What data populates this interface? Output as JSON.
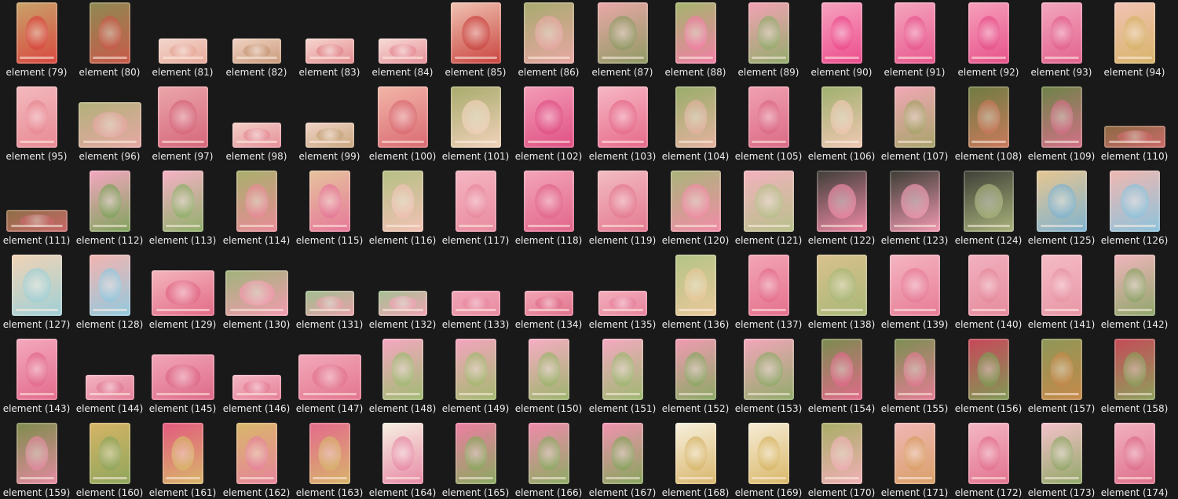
{
  "window": {
    "view": "file-grid",
    "background": "#191919"
  },
  "items": [
    {
      "label": "element (79)",
      "icon": "heart-topiary-icon",
      "colors": [
        "#c9a36a",
        "#d8483f"
      ],
      "shape": "tall"
    },
    {
      "label": "element (80)",
      "icon": "ball-topiary-icon",
      "colors": [
        "#8e8a52",
        "#c95a4a"
      ],
      "shape": "tall"
    },
    {
      "label": "element (81)",
      "icon": "open-book-icon",
      "colors": [
        "#f3d6cc",
        "#e7a99a"
      ],
      "shape": "flat"
    },
    {
      "label": "element (82)",
      "icon": "open-book-icon",
      "colors": [
        "#f0d3c3",
        "#c99a7a"
      ],
      "shape": "flat"
    },
    {
      "label": "element (83)",
      "icon": "open-planner-icon",
      "colors": [
        "#f6d7d0",
        "#e38a8f"
      ],
      "shape": "flat"
    },
    {
      "label": "element (84)",
      "icon": "open-planner-icon",
      "colors": [
        "#f7dcd6",
        "#e58e98"
      ],
      "shape": "flat"
    },
    {
      "label": "element (85)",
      "icon": "book-stack-apple-icon",
      "colors": [
        "#f0c3b2",
        "#c9443f"
      ],
      "shape": "square"
    },
    {
      "label": "element (86)",
      "icon": "book-stack-icon",
      "colors": [
        "#a7aa6e",
        "#e8a7a4"
      ],
      "shape": "square"
    },
    {
      "label": "element (87)",
      "icon": "book-stack-icon",
      "colors": [
        "#eaa8a8",
        "#8f9a64"
      ],
      "shape": "square"
    },
    {
      "label": "element (88)",
      "icon": "clipboard-frame-icon",
      "colors": [
        "#a3b56d",
        "#f27fa6"
      ],
      "shape": "tall"
    },
    {
      "label": "element (89)",
      "icon": "clipboard-frame-icon",
      "colors": [
        "#f3a2b4",
        "#93ac6c"
      ],
      "shape": "tall"
    },
    {
      "label": "element (90)",
      "icon": "floral-wreath-frame-icon",
      "colors": [
        "#f6a3bf",
        "#ec4d8d"
      ],
      "shape": "tall"
    },
    {
      "label": "element (91)",
      "icon": "floral-frame-icon",
      "colors": [
        "#f4a5bd",
        "#e8598f"
      ],
      "shape": "tall"
    },
    {
      "label": "element (92)",
      "icon": "heart-frame-icon",
      "colors": [
        "#f7a0bb",
        "#e6528a"
      ],
      "shape": "tall"
    },
    {
      "label": "element (93)",
      "icon": "oval-floral-frame-icon",
      "colors": [
        "#f3a7be",
        "#e2628e"
      ],
      "shape": "tall"
    },
    {
      "label": "element (94)",
      "icon": "oval-frame-icon",
      "colors": [
        "#f2c3b4",
        "#d7b46a"
      ],
      "shape": "tall"
    },
    {
      "label": "element (95)",
      "icon": "rect-frame-icon",
      "colors": [
        "#f3b9bd",
        "#e88a94"
      ],
      "shape": "tall"
    },
    {
      "label": "element (96)",
      "icon": "duffel-bag-icon",
      "colors": [
        "#b1b07a",
        "#e7a8a4"
      ],
      "shape": "wide"
    },
    {
      "label": "element (97)",
      "icon": "drawstring-bag-icon",
      "colors": [
        "#eba6aa",
        "#d5667a"
      ],
      "shape": "square"
    },
    {
      "label": "element (98)",
      "icon": "label-plate-icon",
      "colors": [
        "#f3d2c8",
        "#e58e98"
      ],
      "shape": "flat"
    },
    {
      "label": "element (99)",
      "icon": "label-plate-icon",
      "colors": [
        "#f1d4c7",
        "#c8a67e"
      ],
      "shape": "flat"
    },
    {
      "label": "element (100)",
      "icon": "trunk-box-icon",
      "colors": [
        "#f2b6a8",
        "#d96a72"
      ],
      "shape": "square"
    },
    {
      "label": "element (101)",
      "icon": "hat-box-icon",
      "colors": [
        "#a8ab6c",
        "#f1d2bb"
      ],
      "shape": "square"
    },
    {
      "label": "element (102)",
      "icon": "jewelry-box-icon",
      "colors": [
        "#f39db7",
        "#df4f83"
      ],
      "shape": "square"
    },
    {
      "label": "element (103)",
      "icon": "perfume-box-icon",
      "colors": [
        "#f6b7c4",
        "#e66a8a"
      ],
      "shape": "square"
    },
    {
      "label": "element (104)",
      "icon": "quill-feather-icon",
      "colors": [
        "#98ad6a",
        "#e4b2a0"
      ],
      "shape": "tall"
    },
    {
      "label": "element (105)",
      "icon": "quill-feather-icon",
      "colors": [
        "#f0a1b1",
        "#db6a86"
      ],
      "shape": "tall"
    },
    {
      "label": "element (106)",
      "icon": "inkwell-quill-icon",
      "colors": [
        "#9fb06e",
        "#f0c8b3"
      ],
      "shape": "tall"
    },
    {
      "label": "element (107)",
      "icon": "inkwell-quill-icon",
      "colors": [
        "#f2a8b6",
        "#a7a46a"
      ],
      "shape": "tall"
    },
    {
      "label": "element (108)",
      "icon": "topiary-clock-icon",
      "colors": [
        "#6f7c42",
        "#c97a5c"
      ],
      "shape": "tall"
    },
    {
      "label": "element (109)",
      "icon": "cone-topiary-icon",
      "colors": [
        "#6c8347",
        "#d47088"
      ],
      "shape": "tall"
    },
    {
      "label": "element (110)",
      "icon": "floral-border-icon",
      "colors": [
        "#8a6a42",
        "#cc6a6a"
      ],
      "shape": "strip"
    },
    {
      "label": "element (111)",
      "icon": "floral-border-icon",
      "colors": [
        "#8c6e45",
        "#c9686a"
      ],
      "shape": "strip"
    },
    {
      "label": "element (112)",
      "icon": "peony-bouquet-icon",
      "colors": [
        "#f5a6c0",
        "#7fa35c"
      ],
      "shape": "tall"
    },
    {
      "label": "element (113)",
      "icon": "peony-bouquet-icon",
      "colors": [
        "#f7b1c6",
        "#8fb06a"
      ],
      "shape": "tall"
    },
    {
      "label": "element (114)",
      "icon": "microscope-icon",
      "colors": [
        "#a8b06c",
        "#e98a98"
      ],
      "shape": "tall"
    },
    {
      "label": "element (115)",
      "icon": "cash-register-icon",
      "colors": [
        "#e6c39c",
        "#e6789a"
      ],
      "shape": "tall"
    },
    {
      "label": "element (116)",
      "icon": "calculator-icon",
      "colors": [
        "#b5bf83",
        "#f1c2b6"
      ],
      "shape": "tall"
    },
    {
      "label": "element (117)",
      "icon": "calculator-icon",
      "colors": [
        "#f5b5c2",
        "#e88b9f"
      ],
      "shape": "tall"
    },
    {
      "label": "element (118)",
      "icon": "wall-clock-icon",
      "colors": [
        "#f3a5b8",
        "#e1658b"
      ],
      "shape": "square"
    },
    {
      "label": "element (119)",
      "icon": "alarm-clock-icon",
      "colors": [
        "#f2bcc2",
        "#e47990"
      ],
      "shape": "square"
    },
    {
      "label": "element (120)",
      "icon": "school-desk-icon",
      "colors": [
        "#a9b47a",
        "#f28ca7"
      ],
      "shape": "square"
    },
    {
      "label": "element (121)",
      "icon": "school-desk-icon",
      "colors": [
        "#f3b2be",
        "#b7c08b"
      ],
      "shape": "square"
    },
    {
      "label": "element (122)",
      "icon": "easel-chalkboard-icon",
      "colors": [
        "#3e3e37",
        "#f08aa6"
      ],
      "shape": "square"
    },
    {
      "label": "element (123)",
      "icon": "chalkboard-icon",
      "colors": [
        "#3b3c34",
        "#f29ab2"
      ],
      "shape": "square"
    },
    {
      "label": "element (124)",
      "icon": "chalkboard-icon",
      "colors": [
        "#3d3f36",
        "#a9b37c"
      ],
      "shape": "square"
    },
    {
      "label": "element (125)",
      "icon": "crayon-tin-icon",
      "colors": [
        "#e7c691",
        "#7fb3d0"
      ],
      "shape": "square"
    },
    {
      "label": "element (126)",
      "icon": "crayon-box-icon",
      "colors": [
        "#f0b7b0",
        "#8cc3dc"
      ],
      "shape": "square"
    },
    {
      "label": "element (127)",
      "icon": "pencil-cup-icon",
      "colors": [
        "#f1d3b5",
        "#9fd0d6"
      ],
      "shape": "square"
    },
    {
      "label": "element (128)",
      "icon": "crayon-pack-icon",
      "colors": [
        "#f3b4b0",
        "#93c9de"
      ],
      "shape": "tall"
    },
    {
      "label": "element (129)",
      "icon": "pencil-case-icon",
      "colors": [
        "#f4b6bc",
        "#e26a88"
      ],
      "shape": "wide"
    },
    {
      "label": "element (130)",
      "icon": "pencil-case-icon",
      "colors": [
        "#9fb37a",
        "#f39bb0"
      ],
      "shape": "wide"
    },
    {
      "label": "element (131)",
      "icon": "eyeglasses-icon",
      "colors": [
        "#9fbd8e",
        "#e6a2aa"
      ],
      "shape": "flat"
    },
    {
      "label": "element (132)",
      "icon": "eyeglasses-icon",
      "colors": [
        "#a3c092",
        "#f0a4b5"
      ],
      "shape": "flat"
    },
    {
      "label": "element (133)",
      "icon": "eyeglasses-icon",
      "colors": [
        "#f1a6b8",
        "#e88aa0"
      ],
      "shape": "flat"
    },
    {
      "label": "element (134)",
      "icon": "glasses-case-icon",
      "colors": [
        "#f2a6b6",
        "#e0718c"
      ],
      "shape": "flat"
    },
    {
      "label": "element (135)",
      "icon": "glasses-case-icon",
      "colors": [
        "#f3aebc",
        "#e7849e"
      ],
      "shape": "flat"
    },
    {
      "label": "element (136)",
      "icon": "computer-mouse-icon",
      "colors": [
        "#b3c487",
        "#e9c89a"
      ],
      "shape": "tall"
    },
    {
      "label": "element (137)",
      "icon": "computer-mouse-icon",
      "colors": [
        "#f3a6b5",
        "#e4708e"
      ],
      "shape": "tall"
    },
    {
      "label": "element (138)",
      "icon": "laptop-icon",
      "colors": [
        "#d9c18c",
        "#a9b878"
      ],
      "shape": "square"
    },
    {
      "label": "element (139)",
      "icon": "laptop-icon",
      "colors": [
        "#f4b5c1",
        "#e77c97"
      ],
      "shape": "square"
    },
    {
      "label": "element (140)",
      "icon": "scissors-icon",
      "colors": [
        "#f2b1bf",
        "#e58b9d"
      ],
      "shape": "tall"
    },
    {
      "label": "element (141)",
      "icon": "scissors-icon",
      "colors": [
        "#f5bcc6",
        "#e896a6"
      ],
      "shape": "tall"
    },
    {
      "label": "element (142)",
      "icon": "bookmark-tassel-icon",
      "colors": [
        "#f1b5bd",
        "#8fa66a"
      ],
      "shape": "tall"
    },
    {
      "label": "element (143)",
      "icon": "bookmark-tassel-icon",
      "colors": [
        "#f4a9bd",
        "#e26b8c"
      ],
      "shape": "tall"
    },
    {
      "label": "element (144)",
      "icon": "ruler-icon",
      "colors": [
        "#f4b4c2",
        "#e27f98"
      ],
      "shape": "flat"
    },
    {
      "label": "element (145)",
      "icon": "stapler-icon",
      "colors": [
        "#f2a6b8",
        "#dd6a88"
      ],
      "shape": "wide"
    },
    {
      "label": "element (146)",
      "icon": "tape-dispenser-icon",
      "colors": [
        "#f4b7c3",
        "#e57f98"
      ],
      "shape": "flat"
    },
    {
      "label": "element (147)",
      "icon": "tape-dispenser-icon",
      "colors": [
        "#f3a9ba",
        "#e2758f"
      ],
      "shape": "wide"
    },
    {
      "label": "element (148)",
      "icon": "floral-corner-icon",
      "colors": [
        "#f6a7c1",
        "#9fbb72"
      ],
      "shape": "tall"
    },
    {
      "label": "element (149)",
      "icon": "floral-corner-icon",
      "colors": [
        "#f5a4bf",
        "#a3b96f"
      ],
      "shape": "tall"
    },
    {
      "label": "element (150)",
      "icon": "floral-corner-icon",
      "colors": [
        "#f7adc4",
        "#9cb46c"
      ],
      "shape": "tall"
    },
    {
      "label": "element (151)",
      "icon": "floral-corner-icon",
      "colors": [
        "#f6a9c2",
        "#9db870"
      ],
      "shape": "tall"
    },
    {
      "label": "element (152)",
      "icon": "rose-bouquet-icon",
      "colors": [
        "#f29bb3",
        "#8aa864"
      ],
      "shape": "tall"
    },
    {
      "label": "element (153)",
      "icon": "rose-bouquet-icon",
      "colors": [
        "#f4a6bb",
        "#90ab6a"
      ],
      "shape": "square"
    },
    {
      "label": "element (154)",
      "icon": "cone-topiary-icon",
      "colors": [
        "#7a8c4f",
        "#e06b8a"
      ],
      "shape": "tall"
    },
    {
      "label": "element (155)",
      "icon": "cone-topiary-icon",
      "colors": [
        "#7b8e52",
        "#e37d94"
      ],
      "shape": "tall"
    },
    {
      "label": "element (156)",
      "icon": "arched-door-icon",
      "colors": [
        "#c8475a",
        "#7f9a55"
      ],
      "shape": "tall"
    },
    {
      "label": "element (157)",
      "icon": "arched-door-icon",
      "colors": [
        "#8d9757",
        "#c6894a"
      ],
      "shape": "tall"
    },
    {
      "label": "element (158)",
      "icon": "arched-door-icon",
      "colors": [
        "#c44b58",
        "#8da05c"
      ],
      "shape": "tall"
    },
    {
      "label": "element (159)",
      "icon": "arched-door-icon",
      "colors": [
        "#7d8c4c",
        "#e38aa0"
      ],
      "shape": "tall"
    },
    {
      "label": "element (160)",
      "icon": "moon-charm-icon",
      "colors": [
        "#d6b465",
        "#8fa65d"
      ],
      "shape": "tall"
    },
    {
      "label": "element (161)",
      "icon": "heart-tassel-charm-icon",
      "colors": [
        "#e3597e",
        "#d8b76a"
      ],
      "shape": "tall"
    },
    {
      "label": "element (162)",
      "icon": "moon-star-charm-icon",
      "colors": [
        "#d9b86a",
        "#e6839b"
      ],
      "shape": "tall"
    },
    {
      "label": "element (163)",
      "icon": "heart-ornament-charm-icon",
      "colors": [
        "#e46a8c",
        "#d7b46b"
      ],
      "shape": "tall"
    },
    {
      "label": "element (164)",
      "icon": "peony-flower-icon",
      "colors": [
        "#f7f0e2",
        "#e78aa6"
      ],
      "shape": "tall"
    },
    {
      "label": "element (165)",
      "icon": "peony-flower-icon",
      "colors": [
        "#ee7ea3",
        "#89a95f"
      ],
      "shape": "tall"
    },
    {
      "label": "element (166)",
      "icon": "peony-flower-icon",
      "colors": [
        "#f08aac",
        "#8cab63"
      ],
      "shape": "tall"
    },
    {
      "label": "element (167)",
      "icon": "peony-flower-icon",
      "colors": [
        "#f193b0",
        "#86a55d"
      ],
      "shape": "tall"
    },
    {
      "label": "element (168)",
      "icon": "peony-flower-icon",
      "colors": [
        "#f8f1de",
        "#d8b66c"
      ],
      "shape": "tall"
    },
    {
      "label": "element (169)",
      "icon": "peony-flower-icon",
      "colors": [
        "#f6ecd6",
        "#d9b768"
      ],
      "shape": "tall"
    },
    {
      "label": "element (170)",
      "icon": "sewing-box-icon",
      "colors": [
        "#a8ad66",
        "#f0b0b6"
      ],
      "shape": "tall"
    },
    {
      "label": "element (171)",
      "icon": "sewing-box-icon",
      "colors": [
        "#f1b7b6",
        "#d9a068"
      ],
      "shape": "tall"
    },
    {
      "label": "element (172)",
      "icon": "thermos-icon",
      "colors": [
        "#f4b8c4",
        "#e2728f"
      ],
      "shape": "tall"
    },
    {
      "label": "element (173)",
      "icon": "thermos-icon",
      "colors": [
        "#f6c2cb",
        "#91a868"
      ],
      "shape": "tall"
    },
    {
      "label": "element (174)",
      "icon": "thermos-icon",
      "colors": [
        "#f2b2c0",
        "#de6f8c"
      ],
      "shape": "tall"
    }
  ]
}
